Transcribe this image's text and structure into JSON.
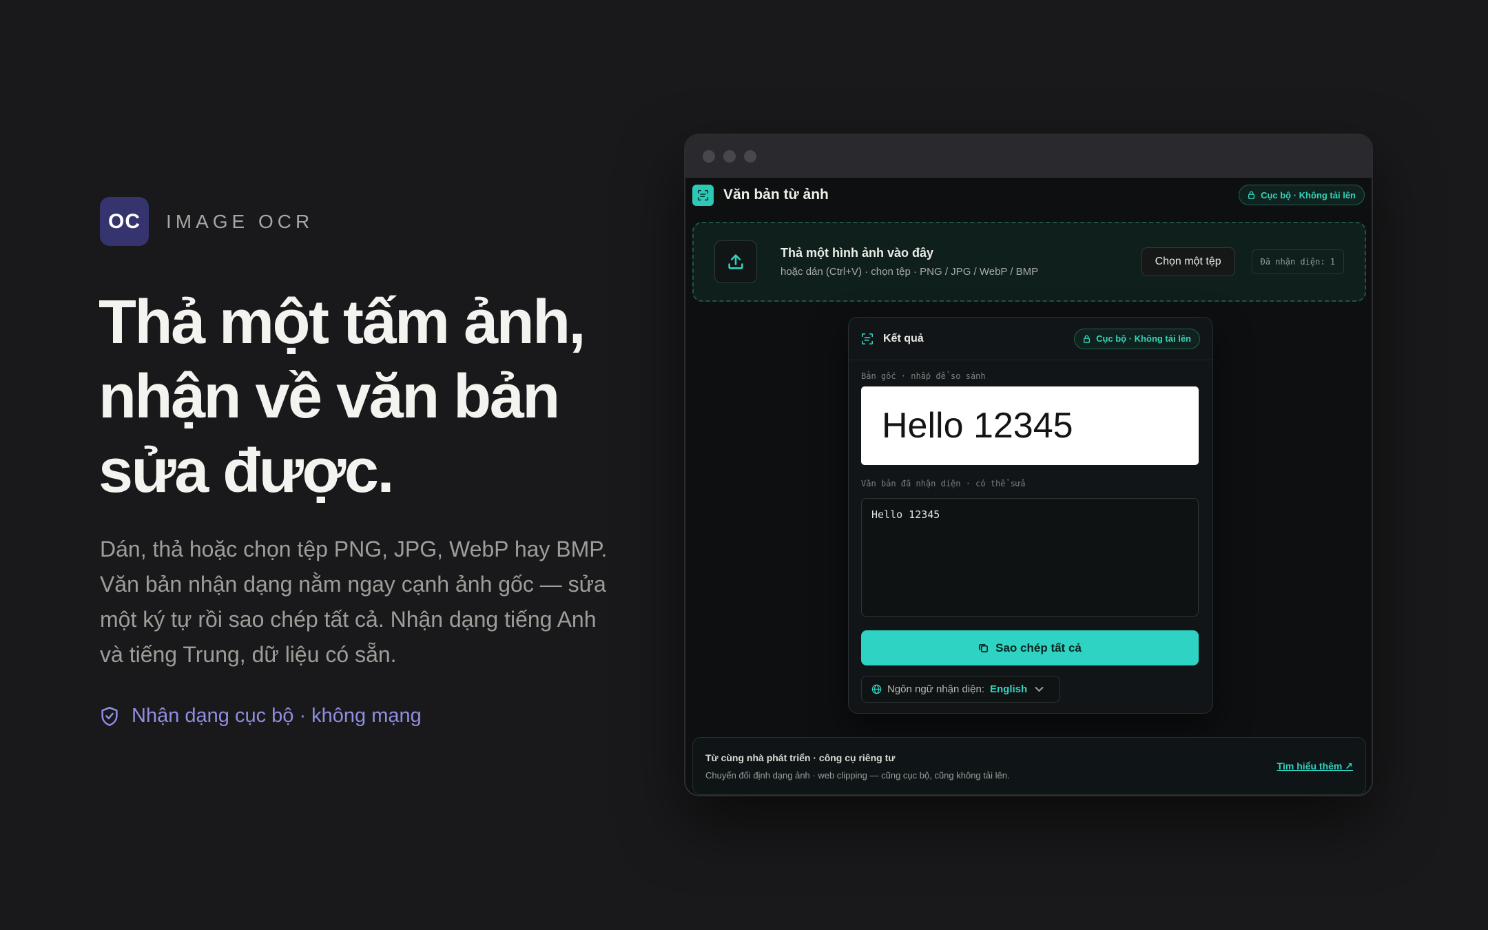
{
  "brand": {
    "badge": "OC",
    "name": "IMAGE OCR"
  },
  "hero": {
    "headline": "Thả một tấm ảnh, nhận về văn bản sửa được.",
    "lead": "Dán, thả hoặc chọn tệp PNG, JPG, WebP hay BMP. Văn bản nhận dạng nằm ngay cạnh ảnh gốc — sửa một ký tự rồi sao chép tất cả. Nhận dạng tiếng Anh và tiếng Trung, dữ liệu có sẵn.",
    "trust": "Nhận dạng cục bộ · không mạng"
  },
  "app": {
    "title": "Văn bản từ ảnh",
    "privacy_pill": "Cục bộ · Không tải lên",
    "dropzone": {
      "title": "Thả một hình ảnh vào đây",
      "subtitle": "hoặc dán (Ctrl+V) · chọn tệp · PNG / JPG / WebP / BMP",
      "choose_button": "Chọn một tệp",
      "recognized_count": "Đã nhận diện: 1"
    },
    "result": {
      "title": "Kết quả",
      "privacy_pill": "Cục bộ · Không tải lên",
      "original_label": "Bản gốc · nhấp để so sánh",
      "original_image_text": "Hello 12345",
      "recognized_label": "Văn bản đã nhận diện · có thể sửa",
      "recognized_text": "Hello 12345",
      "copy_button": "Sao chép tất cả",
      "language_label": "Ngôn ngữ nhận diện:",
      "language_value": "English"
    },
    "footer": {
      "title": "Từ cùng nhà phát triển · công cụ riêng tư",
      "subtitle": "Chuyển đổi định dạng ảnh · web clipping — cũng cục bộ, cũng không tải lên.",
      "link": "Tìm hiểu thêm ↗"
    }
  },
  "colors": {
    "background": "#19191b",
    "brand_badge": "#35346f",
    "accent_teal": "#2fd3c3",
    "trust_violet": "#8f8ee0"
  },
  "icons": [
    "shield-check-icon",
    "scan-text-icon",
    "lock-icon",
    "upload-icon",
    "copy-icon",
    "globe-icon",
    "chevron-down-icon"
  ]
}
